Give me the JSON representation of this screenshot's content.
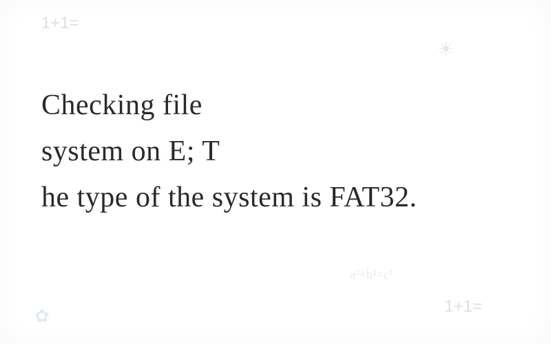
{
  "main": {
    "line1": "Checking file",
    "line2": "system on E; T",
    "line3": "he type of the system is FAT32."
  },
  "watermarks": {
    "top_left": "1+1=",
    "bottom_right": "1+1="
  },
  "doodles": {
    "sun": "☀",
    "flower": "✿",
    "equation": "a²+b²=c²"
  }
}
